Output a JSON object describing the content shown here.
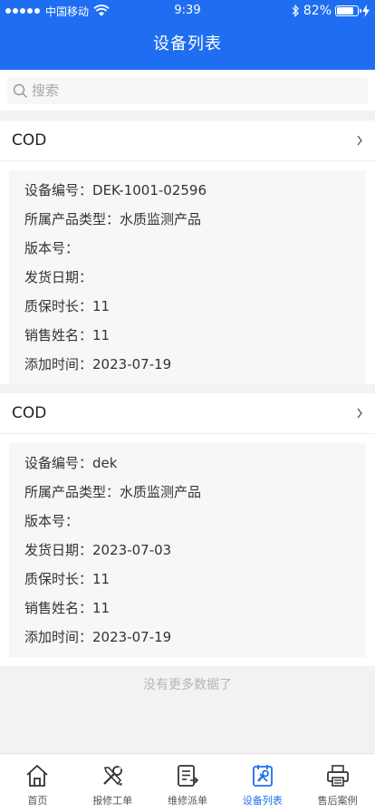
{
  "status_bar": {
    "carrier": "中国移动",
    "time": "9:39",
    "battery": "82%",
    "battery_level": 0.82
  },
  "header": {
    "title": "设备列表"
  },
  "search": {
    "placeholder": "搜索"
  },
  "devices": [
    {
      "name": "COD",
      "fields": [
        {
          "label": "设备编号：",
          "value": "DEK-1001-02596"
        },
        {
          "label": "所属产品类型：",
          "value": "水质监测产品"
        },
        {
          "label": "版本号：",
          "value": ""
        },
        {
          "label": "发货日期：",
          "value": ""
        },
        {
          "label": "质保时长：",
          "value": "11"
        },
        {
          "label": "销售姓名：",
          "value": "11"
        },
        {
          "label": "添加时间：",
          "value": "2023-07-19"
        }
      ]
    },
    {
      "name": "COD",
      "fields": [
        {
          "label": "设备编号：",
          "value": "dek"
        },
        {
          "label": "所属产品类型：",
          "value": "水质监测产品"
        },
        {
          "label": "版本号：",
          "value": ""
        },
        {
          "label": "发货日期：",
          "value": "2023-07-03"
        },
        {
          "label": "质保时长：",
          "value": "11"
        },
        {
          "label": "销售姓名：",
          "value": "11"
        },
        {
          "label": "添加时间：",
          "value": "2023-07-19"
        }
      ]
    }
  ],
  "footer": {
    "no_more": "没有更多数据了"
  },
  "tabbar": {
    "active_color": "#1f6ef2",
    "items": [
      {
        "label": "首页",
        "icon": "home-icon"
      },
      {
        "label": "报修工单",
        "icon": "tools-icon"
      },
      {
        "label": "维修派单",
        "icon": "dispatch-icon"
      },
      {
        "label": "设备列表",
        "icon": "device-list-icon",
        "active": true
      },
      {
        "label": "售后案例",
        "icon": "printer-icon"
      }
    ]
  }
}
